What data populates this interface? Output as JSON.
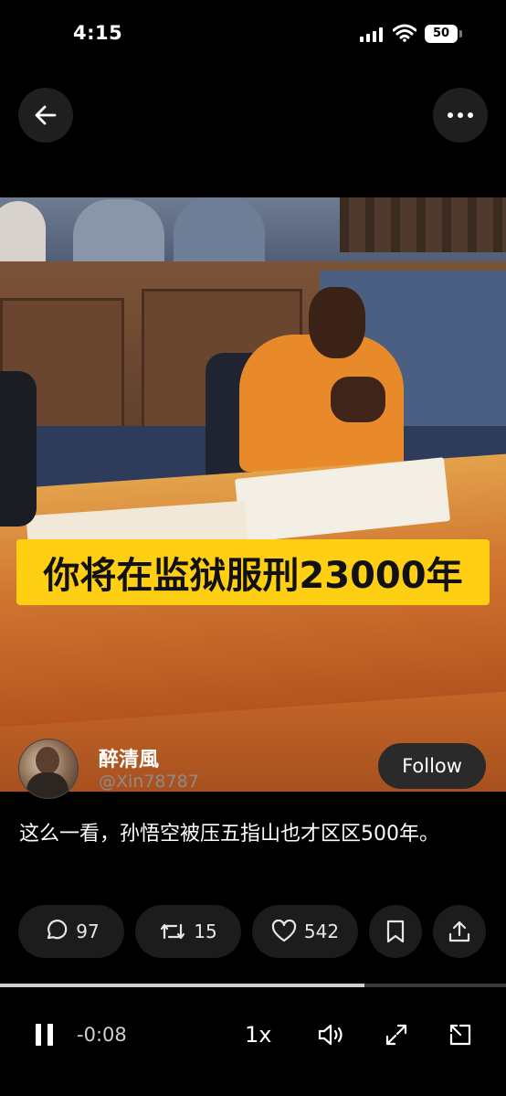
{
  "status_bar": {
    "time": "4:15",
    "battery": "50"
  },
  "nav": {
    "back_icon": "arrow-left-icon",
    "more_icon": "more-horizontal-icon"
  },
  "video": {
    "caption": "你将在监狱服刑23000年"
  },
  "author": {
    "name": "醉清風",
    "handle": "@Xin78787",
    "follow_label": "Follow"
  },
  "post": {
    "text": "这么一看，孙悟空被压五指山也才区区500年。"
  },
  "actions": {
    "replies": "97",
    "reposts": "15",
    "likes": "542"
  },
  "player": {
    "remaining": "-0:08",
    "speed": "1x",
    "progress": 0.72
  }
}
